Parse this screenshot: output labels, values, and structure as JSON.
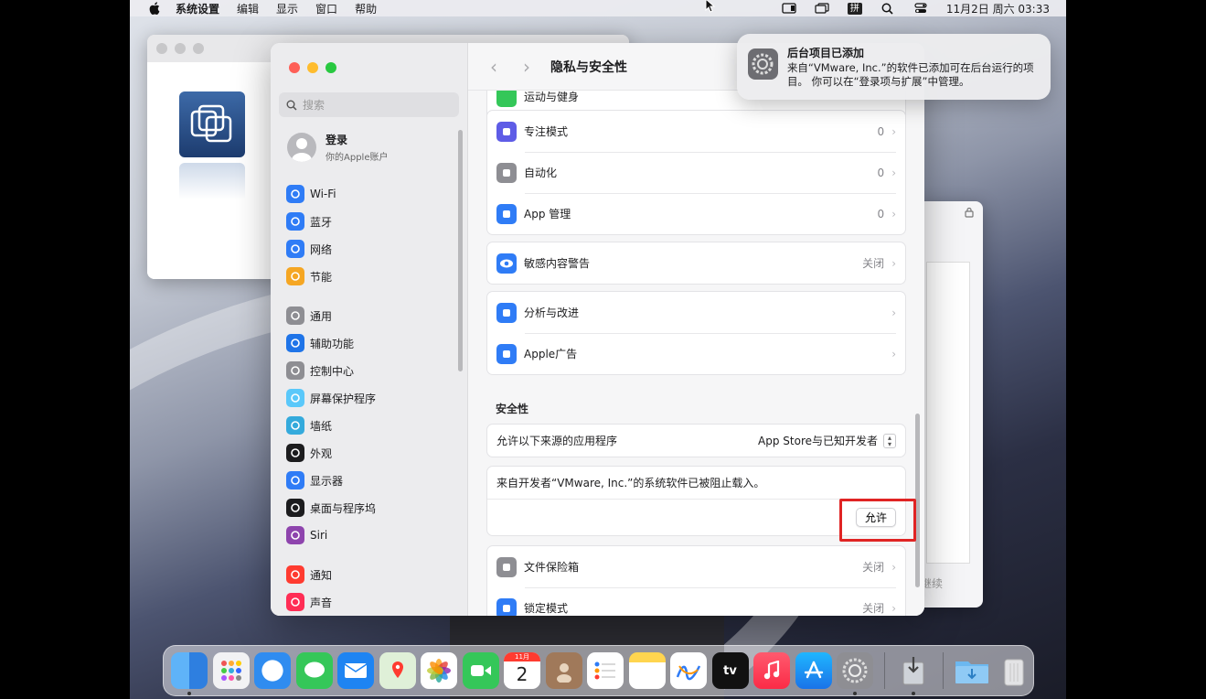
{
  "menubar": {
    "app": "系统设置",
    "items": [
      "编辑",
      "显示",
      "窗口",
      "帮助"
    ],
    "ime": "拼",
    "datetime": "11月2日 周六 03:33"
  },
  "sidebar": {
    "search_placeholder": "搜索",
    "account_title": "登录",
    "account_sub": "你的Apple账户",
    "items": [
      {
        "label": "Wi-Fi",
        "color": "#2f7cf6",
        "icon": "wifi-icon"
      },
      {
        "label": "蓝牙",
        "color": "#2f7cf6",
        "icon": "bluetooth-icon"
      },
      {
        "label": "网络",
        "color": "#2f7cf6",
        "icon": "globe-icon"
      },
      {
        "label": "节能",
        "color": "#f5a623",
        "icon": "bulb-icon"
      },
      {
        "label": "通用",
        "color": "#8e8e93",
        "icon": "gear-icon"
      },
      {
        "label": "辅助功能",
        "color": "#1f74e8",
        "icon": "accessibility-icon"
      },
      {
        "label": "控制中心",
        "color": "#8e8e93",
        "icon": "toggles-icon"
      },
      {
        "label": "屏幕保护程序",
        "color": "#5ac8fa",
        "icon": "screensaver-icon"
      },
      {
        "label": "墙纸",
        "color": "#34aadc",
        "icon": "flower-icon"
      },
      {
        "label": "外观",
        "color": "#1c1c1e",
        "icon": "appearance-icon"
      },
      {
        "label": "显示器",
        "color": "#2f7cf6",
        "icon": "sun-icon"
      },
      {
        "label": "桌面与程序坞",
        "color": "#1c1c1e",
        "icon": "dock-icon"
      },
      {
        "label": "Siri",
        "color": "#8e44ad",
        "icon": "siri-icon"
      },
      {
        "label": "通知",
        "color": "#ff3b30",
        "icon": "bell-icon"
      },
      {
        "label": "声音",
        "color": "#ff2d55",
        "icon": "speaker-icon"
      }
    ]
  },
  "content": {
    "title": "隐私与安全性",
    "partial_top": "运动与健身",
    "group1": [
      {
        "label": "专注模式",
        "value": "0",
        "color": "#5e5ce6",
        "icon": "moon-icon"
      },
      {
        "label": "自动化",
        "value": "0",
        "color": "#8e8e93",
        "icon": "gears-icon"
      },
      {
        "label": "App 管理",
        "value": "0",
        "color": "#2f7cf6",
        "icon": "appstore-icon"
      }
    ],
    "sensitive": {
      "label": "敏感内容警告",
      "value": "关闭"
    },
    "group3": [
      {
        "label": "分析与改进",
        "icon": "chart-icon"
      },
      {
        "label": "Apple广告",
        "icon": "megaphone-icon"
      }
    ],
    "security_heading": "安全性",
    "allow_label": "允许以下来源的应用程序",
    "allow_value": "App Store与已知开发者",
    "blocked_msg": "来自开发者“VMware, Inc.”的系统软件已被阻止载入。",
    "allow_button": "允许",
    "group5": [
      {
        "label": "文件保险箱",
        "value": "关闭",
        "icon": "vault-icon"
      },
      {
        "label": "锁定模式",
        "value": "关闭",
        "icon": "hand-icon"
      }
    ]
  },
  "notification": {
    "title": "后台项目已添加",
    "body": "来自“VMware, Inc.”的软件已添加可在后台运行的项目。 你可以在“登录项与扩展”中管理。"
  },
  "bg_window": {
    "continue": "继续"
  },
  "calendar": {
    "month": "11月",
    "day": "2"
  },
  "appletv": "tv"
}
